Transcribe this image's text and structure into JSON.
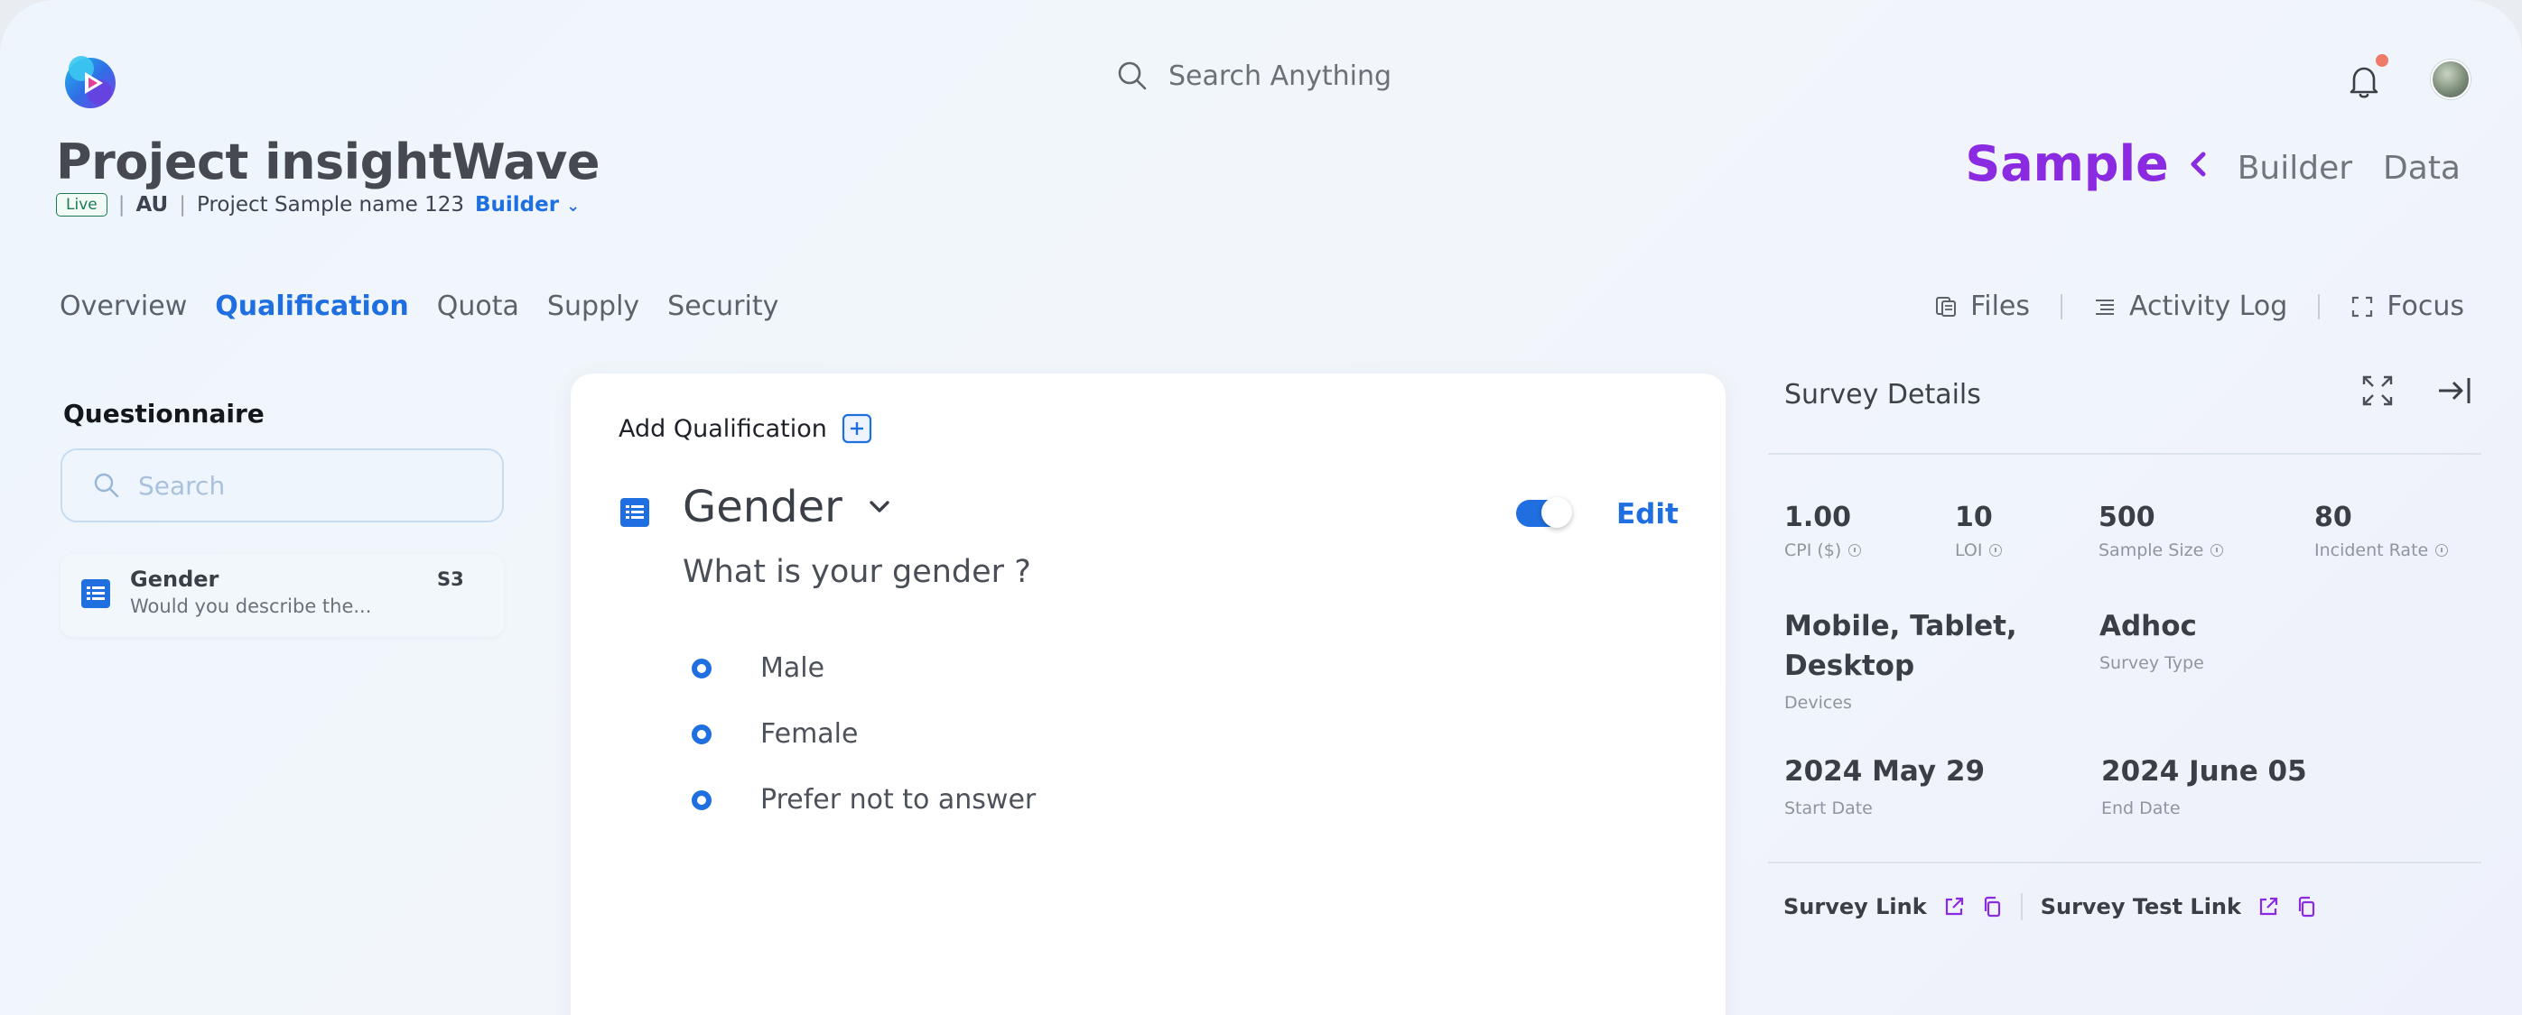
{
  "header": {
    "search_placeholder": "Search Anything",
    "icons": {
      "logo": "logo-icon",
      "search": "search-icon",
      "bell": "bell-icon",
      "avatar": "avatar"
    },
    "notification_dot_color": "#f07a6a"
  },
  "project": {
    "title": "Project insightWave",
    "status": "Live",
    "region": "AU",
    "sample_name": "Project Sample name 123",
    "builder_label": "Builder",
    "builder_chevron": "⌄"
  },
  "modes": {
    "active": "Sample",
    "items": [
      "Builder",
      "Data"
    ],
    "accent_color": "#8a2be2"
  },
  "tabs": {
    "items": [
      "Overview",
      "Qualification",
      "Quota",
      "Supply",
      "Security"
    ],
    "active": "Qualification",
    "accent_color": "#1f6fe0"
  },
  "tools": {
    "files": "Files",
    "activity_log": "Activity Log",
    "focus": "Focus"
  },
  "questionnaire": {
    "title": "Questionnaire",
    "search_placeholder": "Search",
    "items": [
      {
        "name": "Gender",
        "description": "Would you describe the...",
        "code": "S3"
      }
    ]
  },
  "qualification": {
    "add_label": "Add Qualification",
    "name": "Gender",
    "enabled": true,
    "edit_label": "Edit",
    "question": "What is your gender ?",
    "options": [
      "Male",
      "Female",
      "Prefer not to answer"
    ]
  },
  "survey_details": {
    "title": "Survey Details",
    "stats": [
      {
        "value": "1.00",
        "label": "CPI ($)"
      },
      {
        "value": "10",
        "label": "LOI"
      },
      {
        "value": "500",
        "label": "Sample Size"
      },
      {
        "value": "80",
        "label": "Incident Rate"
      }
    ],
    "devices": {
      "value_line1": "Mobile, Tablet,",
      "value_line2": "Desktop",
      "label": "Devices"
    },
    "survey_type": {
      "value": "Adhoc",
      "label": "Survey Type"
    },
    "start_date": {
      "value": "2024 May 29",
      "label": "Start Date"
    },
    "end_date": {
      "value": "2024 June 05",
      "label": "End Date"
    },
    "survey_link": "Survey Link",
    "survey_test_link": "Survey Test Link"
  }
}
